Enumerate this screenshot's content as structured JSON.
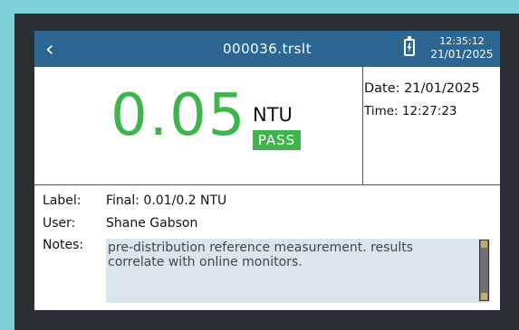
{
  "header": {
    "title": "000036.trslt",
    "time": "12:35:12",
    "date": "21/01/2025"
  },
  "reading": {
    "value": "0.05",
    "unit": "NTU",
    "status": "PASS",
    "date_text": "Date: 21/01/2025",
    "time_text": "Time: 12:27:23"
  },
  "details": {
    "label_key": "Label:",
    "label_value": "Final: 0.01/0.2 NTU",
    "user_key": "User:",
    "user_value": "Shane Gabson",
    "notes_key": "Notes:",
    "notes_value": "pre-distribution reference measurement. results correlate with online monitors."
  },
  "colors": {
    "header": "#2c6693",
    "pass": "#3cb54a",
    "notes_bg": "#dbe6ec"
  }
}
